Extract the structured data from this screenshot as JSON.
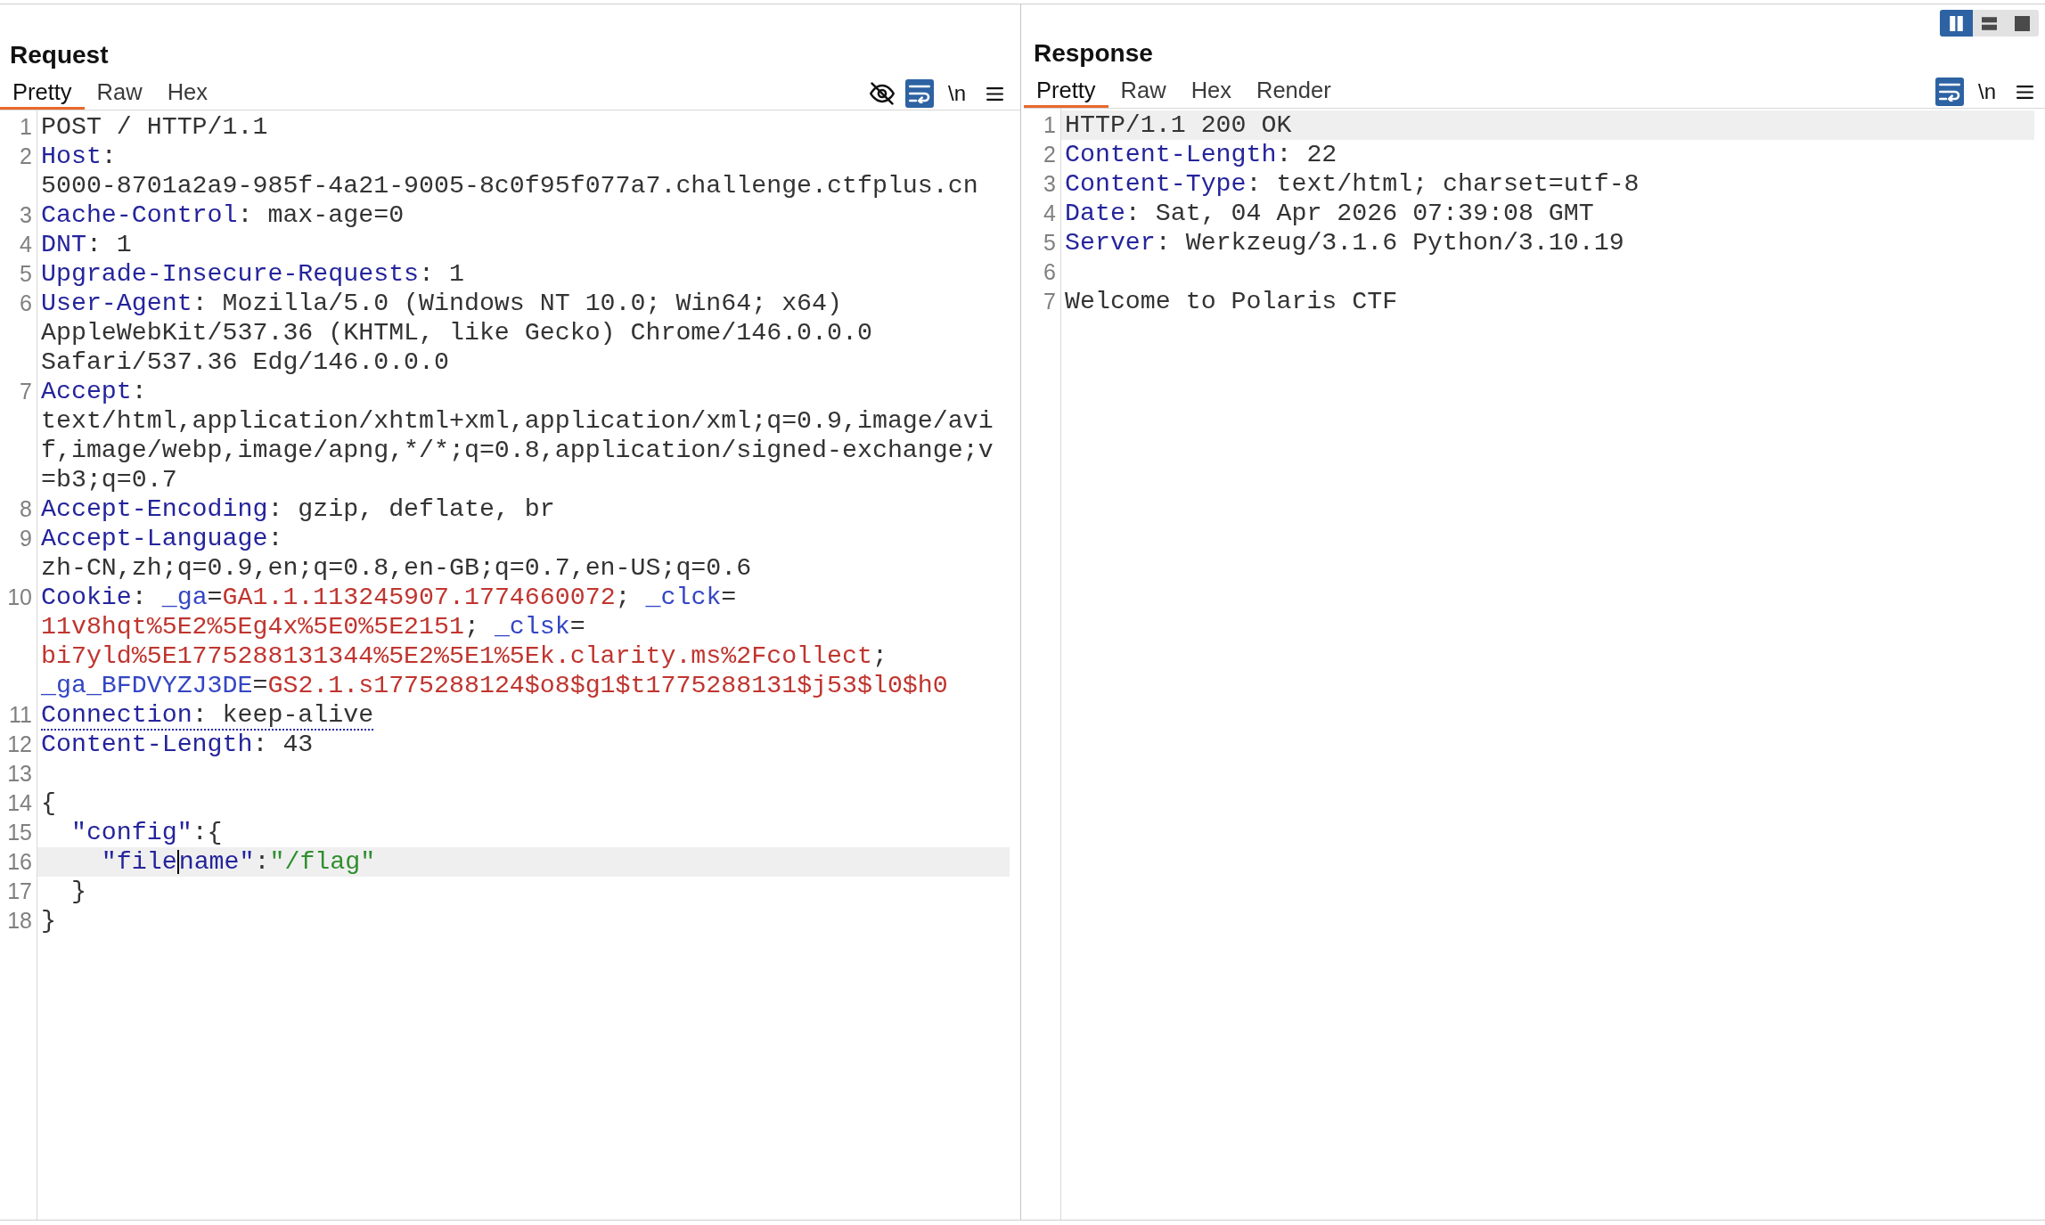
{
  "request": {
    "title": "Request",
    "tabs": [
      {
        "label": "Pretty",
        "selected": true
      },
      {
        "label": "Raw",
        "selected": false
      },
      {
        "label": "Hex",
        "selected": false
      }
    ],
    "tools": [
      {
        "kind": "hide",
        "on": false
      },
      {
        "kind": "wrap",
        "on": true
      },
      {
        "kind": "newlines",
        "label": "\\n",
        "on": false
      },
      {
        "kind": "menu",
        "on": false
      }
    ],
    "lines": [
      {
        "number": "1",
        "highlighted": false,
        "underlined": false,
        "visual_lines": [
          {
            "segments": [
              {
                "kind": "plain",
                "text": "POST / HTTP/1.1"
              }
            ]
          }
        ]
      },
      {
        "number": "2",
        "highlighted": false,
        "underlined": false,
        "visual_lines": [
          {
            "segments": [
              {
                "kind": "name",
                "text": "Host"
              },
              {
                "kind": "plain",
                "text": ":"
              }
            ]
          },
          {
            "segments": [
              {
                "kind": "plain",
                "text": "5000-8701a2a9-985f-4a21-9005-8c0f95f077a7.challenge.ctfplus.cn"
              }
            ]
          }
        ]
      },
      {
        "number": "3",
        "highlighted": false,
        "underlined": false,
        "visual_lines": [
          {
            "segments": [
              {
                "kind": "name",
                "text": "Cache-Control"
              },
              {
                "kind": "plain",
                "text": ": max-age=0"
              }
            ]
          }
        ]
      },
      {
        "number": "4",
        "highlighted": false,
        "underlined": false,
        "visual_lines": [
          {
            "segments": [
              {
                "kind": "name",
                "text": "DNT"
              },
              {
                "kind": "plain",
                "text": ": 1"
              }
            ]
          }
        ]
      },
      {
        "number": "5",
        "highlighted": false,
        "underlined": false,
        "visual_lines": [
          {
            "segments": [
              {
                "kind": "name",
                "text": "Upgrade-Insecure-Requests"
              },
              {
                "kind": "plain",
                "text": ": 1"
              }
            ]
          }
        ]
      },
      {
        "number": "6",
        "highlighted": false,
        "underlined": false,
        "visual_lines": [
          {
            "segments": [
              {
                "kind": "name",
                "text": "User-Agent"
              },
              {
                "kind": "plain",
                "text": ": Mozilla/5.0 (Windows NT 10.0; Win64; x64)"
              }
            ]
          },
          {
            "segments": [
              {
                "kind": "plain",
                "text": "AppleWebKit/537.36 (KHTML, like Gecko) Chrome/146.0.0.0"
              }
            ]
          },
          {
            "segments": [
              {
                "kind": "plain",
                "text": "Safari/537.36 Edg/146.0.0.0"
              }
            ]
          }
        ]
      },
      {
        "number": "7",
        "highlighted": false,
        "underlined": false,
        "visual_lines": [
          {
            "segments": [
              {
                "kind": "name",
                "text": "Accept"
              },
              {
                "kind": "plain",
                "text": ":"
              }
            ]
          },
          {
            "segments": [
              {
                "kind": "plain",
                "text": "text/html,application/xhtml+xml,application/xml;q=0.9,image/avi"
              }
            ]
          },
          {
            "segments": [
              {
                "kind": "plain",
                "text": "f,image/webp,image/apng,*/*;q=0.8,application/signed-exchange;v"
              }
            ]
          },
          {
            "segments": [
              {
                "kind": "plain",
                "text": "=b3;q=0.7"
              }
            ]
          }
        ]
      },
      {
        "number": "8",
        "highlighted": false,
        "underlined": false,
        "visual_lines": [
          {
            "segments": [
              {
                "kind": "name",
                "text": "Accept-Encoding"
              },
              {
                "kind": "plain",
                "text": ": gzip, deflate, br"
              }
            ]
          }
        ]
      },
      {
        "number": "9",
        "highlighted": false,
        "underlined": false,
        "visual_lines": [
          {
            "segments": [
              {
                "kind": "name",
                "text": "Accept-Language"
              },
              {
                "kind": "plain",
                "text": ":"
              }
            ]
          },
          {
            "segments": [
              {
                "kind": "plain",
                "text": "zh-CN,zh;q=0.9,en;q=0.8,en-GB;q=0.7,en-US;q=0.6"
              }
            ]
          }
        ]
      },
      {
        "number": "10",
        "highlighted": false,
        "underlined": false,
        "visual_lines": [
          {
            "segments": [
              {
                "kind": "name",
                "text": "Cookie"
              },
              {
                "kind": "plain",
                "text": ": "
              },
              {
                "kind": "cookie-name",
                "text": "_ga"
              },
              {
                "kind": "plain",
                "text": "="
              },
              {
                "kind": "cookie-value",
                "text": "GA1.1.113245907.1774660072"
              },
              {
                "kind": "plain",
                "text": "; "
              },
              {
                "kind": "cookie-name",
                "text": "_clck"
              },
              {
                "kind": "plain",
                "text": "="
              }
            ]
          },
          {
            "segments": [
              {
                "kind": "cookie-value",
                "text": "11v8hqt%5E2%5Eg4x%5E0%5E2151"
              },
              {
                "kind": "plain",
                "text": "; "
              },
              {
                "kind": "cookie-name",
                "text": "_clsk"
              },
              {
                "kind": "plain",
                "text": "="
              }
            ]
          },
          {
            "segments": [
              {
                "kind": "cookie-value",
                "text": "bi7yld%5E1775288131344%5E2%5E1%5Ek.clarity.ms%2Fcollect"
              },
              {
                "kind": "plain",
                "text": ";"
              }
            ]
          },
          {
            "segments": [
              {
                "kind": "cookie-name",
                "text": "_ga_BFDVYZJ3DE"
              },
              {
                "kind": "plain",
                "text": "="
              },
              {
                "kind": "cookie-value",
                "text": "GS2.1.s1775288124$o8$g1$t1775288131$j53$l0$h0"
              }
            ]
          }
        ]
      },
      {
        "number": "11",
        "highlighted": false,
        "underlined": true,
        "visual_lines": [
          {
            "segments": [
              {
                "kind": "name",
                "text": "Connection"
              },
              {
                "kind": "plain",
                "text": ": keep-alive"
              }
            ]
          }
        ]
      },
      {
        "number": "12",
        "highlighted": false,
        "underlined": false,
        "visual_lines": [
          {
            "segments": [
              {
                "kind": "name",
                "text": "Content-Length"
              },
              {
                "kind": "plain",
                "text": ": 43"
              }
            ]
          }
        ]
      },
      {
        "number": "13",
        "highlighted": false,
        "underlined": false
      },
      {
        "number": "14",
        "highlighted": false,
        "underlined": false,
        "visual_lines": [
          {
            "segments": [
              {
                "kind": "plain",
                "text": "{"
              }
            ]
          }
        ]
      },
      {
        "number": "15",
        "highlighted": false,
        "underlined": false,
        "visual_lines": [
          {
            "segments": [
              {
                "kind": "key",
                "text": "  \"config\""
              },
              {
                "kind": "plain",
                "text": ":{"
              }
            ]
          }
        ]
      },
      {
        "number": "16",
        "highlighted": true,
        "underlined": false,
        "visual_lines": [
          {
            "segments": [
              {
                "kind": "key",
                "text": "    \"file"
              },
              {
                "kind": "cursor"
              },
              {
                "kind": "key",
                "text": "name\""
              },
              {
                "kind": "plain",
                "text": ":"
              },
              {
                "kind": "string",
                "text": "\"/flag\""
              }
            ]
          }
        ]
      },
      {
        "number": "17",
        "highlighted": false,
        "underlined": false,
        "visual_lines": [
          {
            "segments": [
              {
                "kind": "plain",
                "text": "  }"
              }
            ]
          }
        ]
      },
      {
        "number": "18",
        "highlighted": false,
        "underlined": false,
        "visual_lines": [
          {
            "segments": [
              {
                "kind": "plain",
                "text": "}"
              }
            ]
          }
        ]
      }
    ]
  },
  "layout_buttons": [
    {
      "kind": "side-by-side",
      "selected": true
    },
    {
      "kind": "stacked",
      "selected": false
    },
    {
      "kind": "single",
      "selected": false
    }
  ],
  "response": {
    "title": "Response",
    "tabs": [
      {
        "label": "Pretty",
        "selected": true
      },
      {
        "label": "Raw",
        "selected": false
      },
      {
        "label": "Hex",
        "selected": false
      },
      {
        "label": "Render",
        "selected": false
      }
    ],
    "tools": [
      {
        "kind": "wrap",
        "on": true
      },
      {
        "kind": "newlines",
        "label": "\\n",
        "on": false
      },
      {
        "kind": "menu",
        "on": false
      }
    ],
    "lines": [
      {
        "number": "1",
        "highlighted": true,
        "underlined": false,
        "visual_lines": [
          {
            "segments": [
              {
                "kind": "plain",
                "text": "HTTP/1.1 200 OK"
              }
            ]
          }
        ]
      },
      {
        "number": "2",
        "highlighted": false,
        "underlined": false,
        "visual_lines": [
          {
            "segments": [
              {
                "kind": "name",
                "text": "Content-Length"
              },
              {
                "kind": "plain",
                "text": ": 22"
              }
            ]
          }
        ]
      },
      {
        "number": "3",
        "highlighted": false,
        "underlined": false,
        "visual_lines": [
          {
            "segments": [
              {
                "kind": "name",
                "text": "Content-Type"
              },
              {
                "kind": "plain",
                "text": ": text/html; charset=utf-8"
              }
            ]
          }
        ]
      },
      {
        "number": "4",
        "highlighted": false,
        "underlined": false,
        "visual_lines": [
          {
            "segments": [
              {
                "kind": "name",
                "text": "Date"
              },
              {
                "kind": "plain",
                "text": ": Sat, 04 Apr 2026 07:39:08 GMT"
              }
            ]
          }
        ]
      },
      {
        "number": "5",
        "highlighted": false,
        "underlined": false,
        "visual_lines": [
          {
            "segments": [
              {
                "kind": "name",
                "text": "Server"
              },
              {
                "kind": "plain",
                "text": ": Werkzeug/3.1.6 Python/3.10.19"
              }
            ]
          }
        ]
      },
      {
        "number": "6",
        "highlighted": false,
        "underlined": false
      },
      {
        "number": "7",
        "highlighted": false,
        "underlined": false,
        "visual_lines": [
          {
            "segments": [
              {
                "kind": "plain",
                "text": "Welcome to Polaris CTF"
              }
            ]
          }
        ]
      }
    ]
  }
}
